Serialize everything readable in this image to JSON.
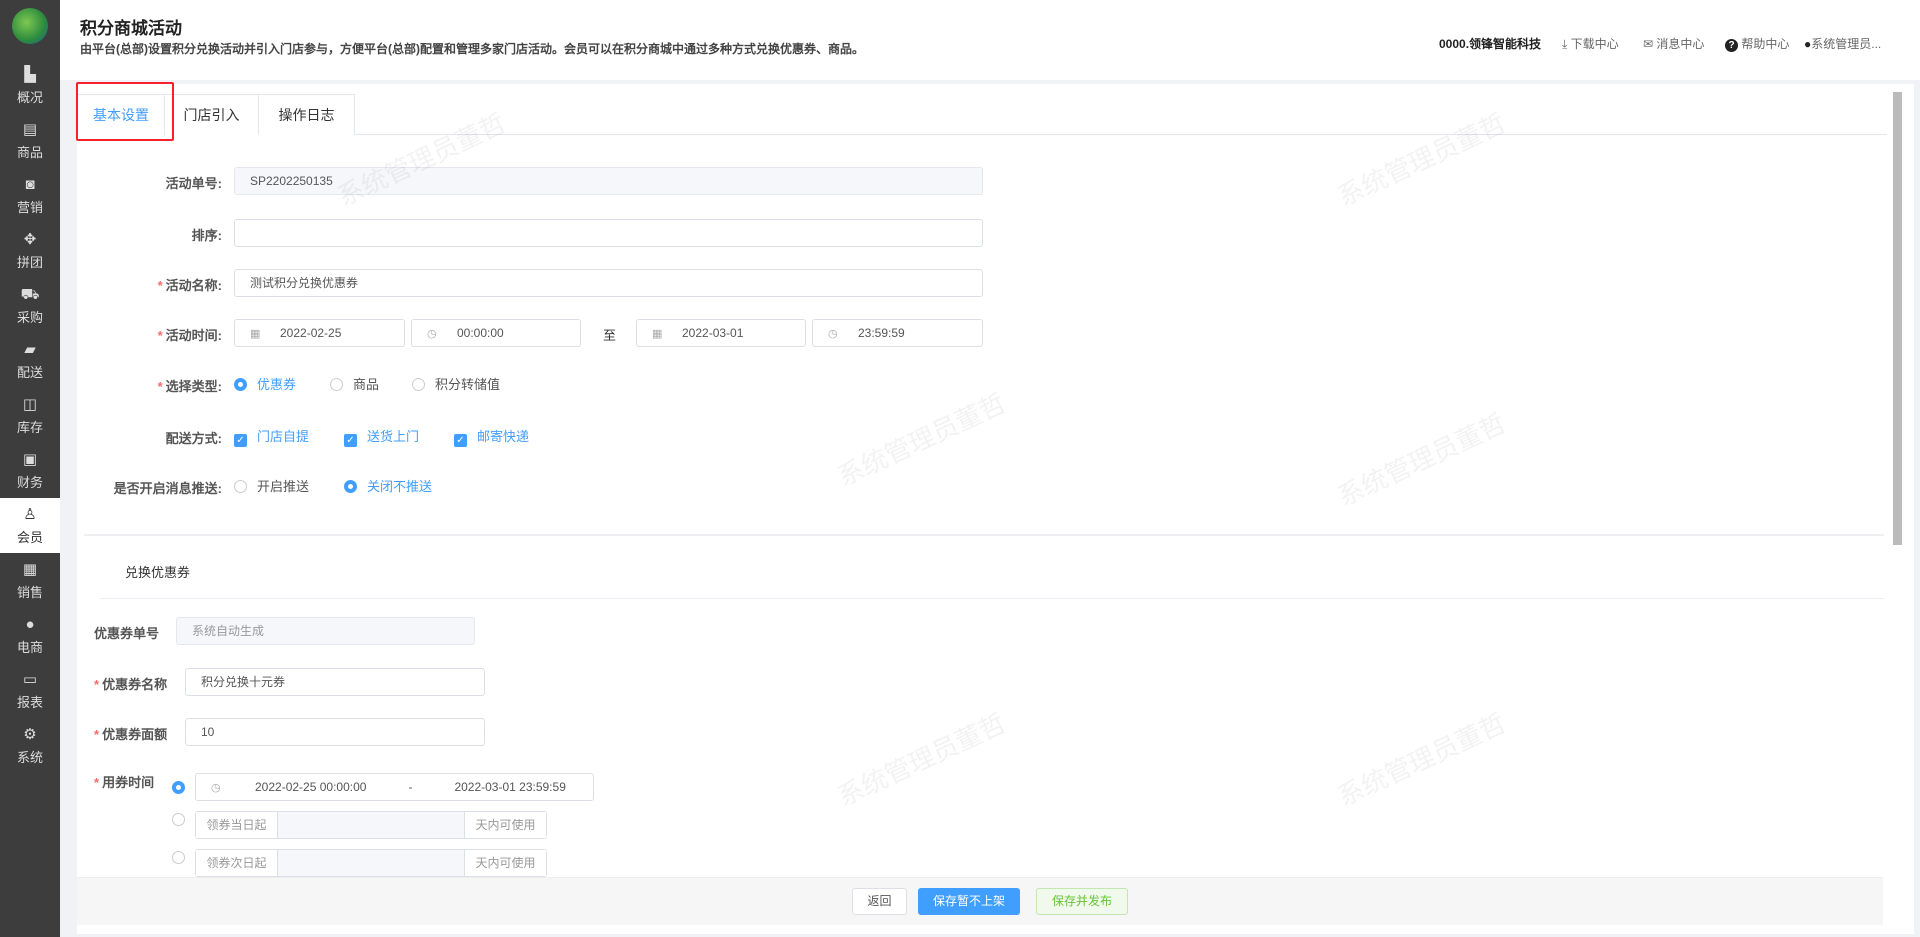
{
  "sidebar": {
    "items": [
      {
        "label": "概况",
        "icon": "building-icon"
      },
      {
        "label": "商品",
        "icon": "document-icon"
      },
      {
        "label": "营销",
        "icon": "marketing-icon"
      },
      {
        "label": "拼团",
        "icon": "group-icon"
      },
      {
        "label": "采购",
        "icon": "cart-icon"
      },
      {
        "label": "配送",
        "icon": "truck-icon"
      },
      {
        "label": "库存",
        "icon": "box-icon"
      },
      {
        "label": "财务",
        "icon": "finance-icon"
      },
      {
        "label": "会员",
        "icon": "user-icon"
      },
      {
        "label": "销售",
        "icon": "cashier-icon"
      },
      {
        "label": "电商",
        "icon": "person-icon"
      },
      {
        "label": "报表",
        "icon": "report-icon"
      },
      {
        "label": "系统",
        "icon": "gear-icon"
      }
    ],
    "active": "会员"
  },
  "header": {
    "title": "积分商城活动",
    "description": "由平台(总部)设置积分兑换活动并引入门店参与，方便平台(总部)配置和管理多家门店活动。会员可以在积分商城中通过多种方式兑换优惠券、商品。",
    "company": "0000.领锋智能科技",
    "download": "下载中心",
    "messages": "消息中心",
    "help": "帮助中心",
    "user": "系统管理员..."
  },
  "tabs": [
    {
      "label": "基本设置"
    },
    {
      "label": "门店引入"
    },
    {
      "label": "操作日志"
    }
  ],
  "form": {
    "activity_no": {
      "label": "活动单号:",
      "value": "SP2202250135"
    },
    "sort": {
      "label": "排序:",
      "value": ""
    },
    "name": {
      "label": "活动名称:",
      "value": "测试积分兑换优惠券"
    },
    "time": {
      "label": "活动时间:",
      "start_date": "2022-02-25",
      "start_time": "00:00:00",
      "separator": "至",
      "end_date": "2022-03-01",
      "end_time": "23:59:59"
    },
    "type": {
      "label": "选择类型:",
      "options": [
        "优惠券",
        "商品",
        "积分转储值"
      ],
      "selected": "优惠券"
    },
    "delivery": {
      "label": "配送方式:",
      "options": [
        "门店自提",
        "送货上门",
        "邮寄快递"
      ]
    },
    "push": {
      "label": "是否开启消息推送:",
      "options": [
        "开启推送",
        "关闭不推送"
      ],
      "selected": "关闭不推送"
    }
  },
  "coupon": {
    "section_title": "兑换优惠券",
    "no": {
      "label": "优惠券单号",
      "placeholder": "系统自动生成"
    },
    "name": {
      "label": "优惠券名称",
      "value": "积分兑换十元券"
    },
    "amount": {
      "label": "优惠券面额",
      "value": "10"
    },
    "time": {
      "label": "用券时间",
      "start": "2022-02-25 00:00:00",
      "separator": "-",
      "end": "2022-03-01 23:59:59",
      "opt2_prefix": "领券当日起",
      "opt3_prefix": "领券次日起",
      "suffix": "天内可使用"
    }
  },
  "footer": {
    "back": "返回",
    "save_draft": "保存暂不上架",
    "save_publish": "保存并发布"
  },
  "watermark": "系统管理员董哲"
}
